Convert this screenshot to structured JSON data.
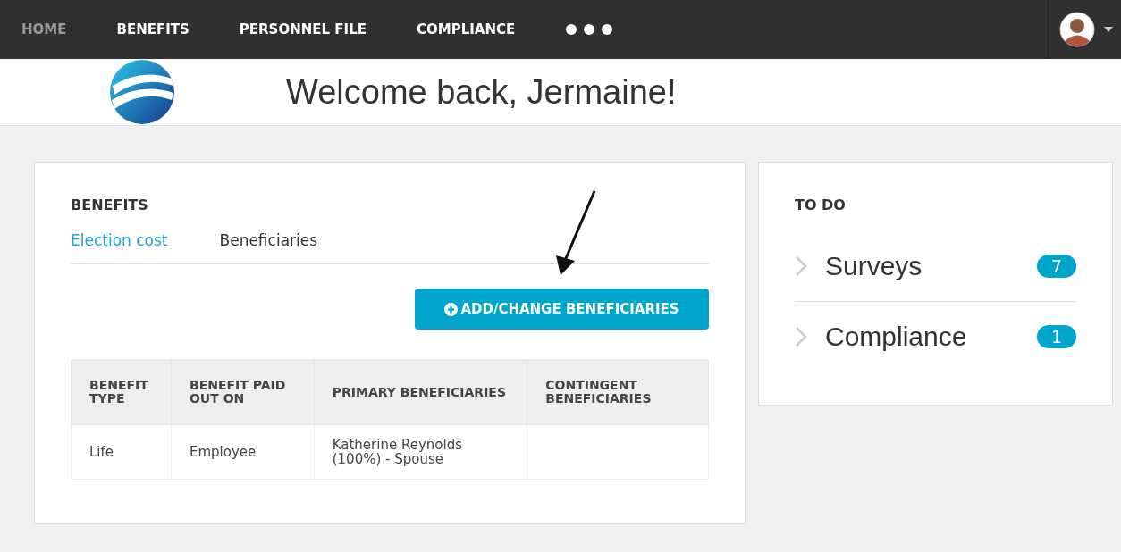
{
  "nav": {
    "items": [
      {
        "label": "HOME",
        "selected": true
      },
      {
        "label": "BENEFITS",
        "selected": false
      },
      {
        "label": "PERSONNEL FILE",
        "selected": false
      },
      {
        "label": "COMPLIANCE",
        "selected": false
      }
    ]
  },
  "header": {
    "greeting": "Welcome back, Jermaine!"
  },
  "benefits": {
    "title": "BENEFITS",
    "tabs": [
      {
        "label": "Election cost",
        "selected": false
      },
      {
        "label": "Beneficiaries",
        "selected": true
      }
    ],
    "button": "ADD/CHANGE BENEFICIARIES",
    "table": {
      "columns": [
        "BENEFIT TYPE",
        "BENEFIT PAID OUT ON",
        "PRIMARY BENEFICIARIES",
        "CONTINGENT BENEFICIARIES"
      ],
      "rows": [
        [
          "Life",
          "Employee",
          "Katherine Reynolds (100%) - Spouse",
          ""
        ]
      ]
    }
  },
  "todo": {
    "title": "TO DO",
    "items": [
      {
        "label": "Surveys",
        "count": "7"
      },
      {
        "label": "Compliance",
        "count": "1"
      }
    ]
  }
}
